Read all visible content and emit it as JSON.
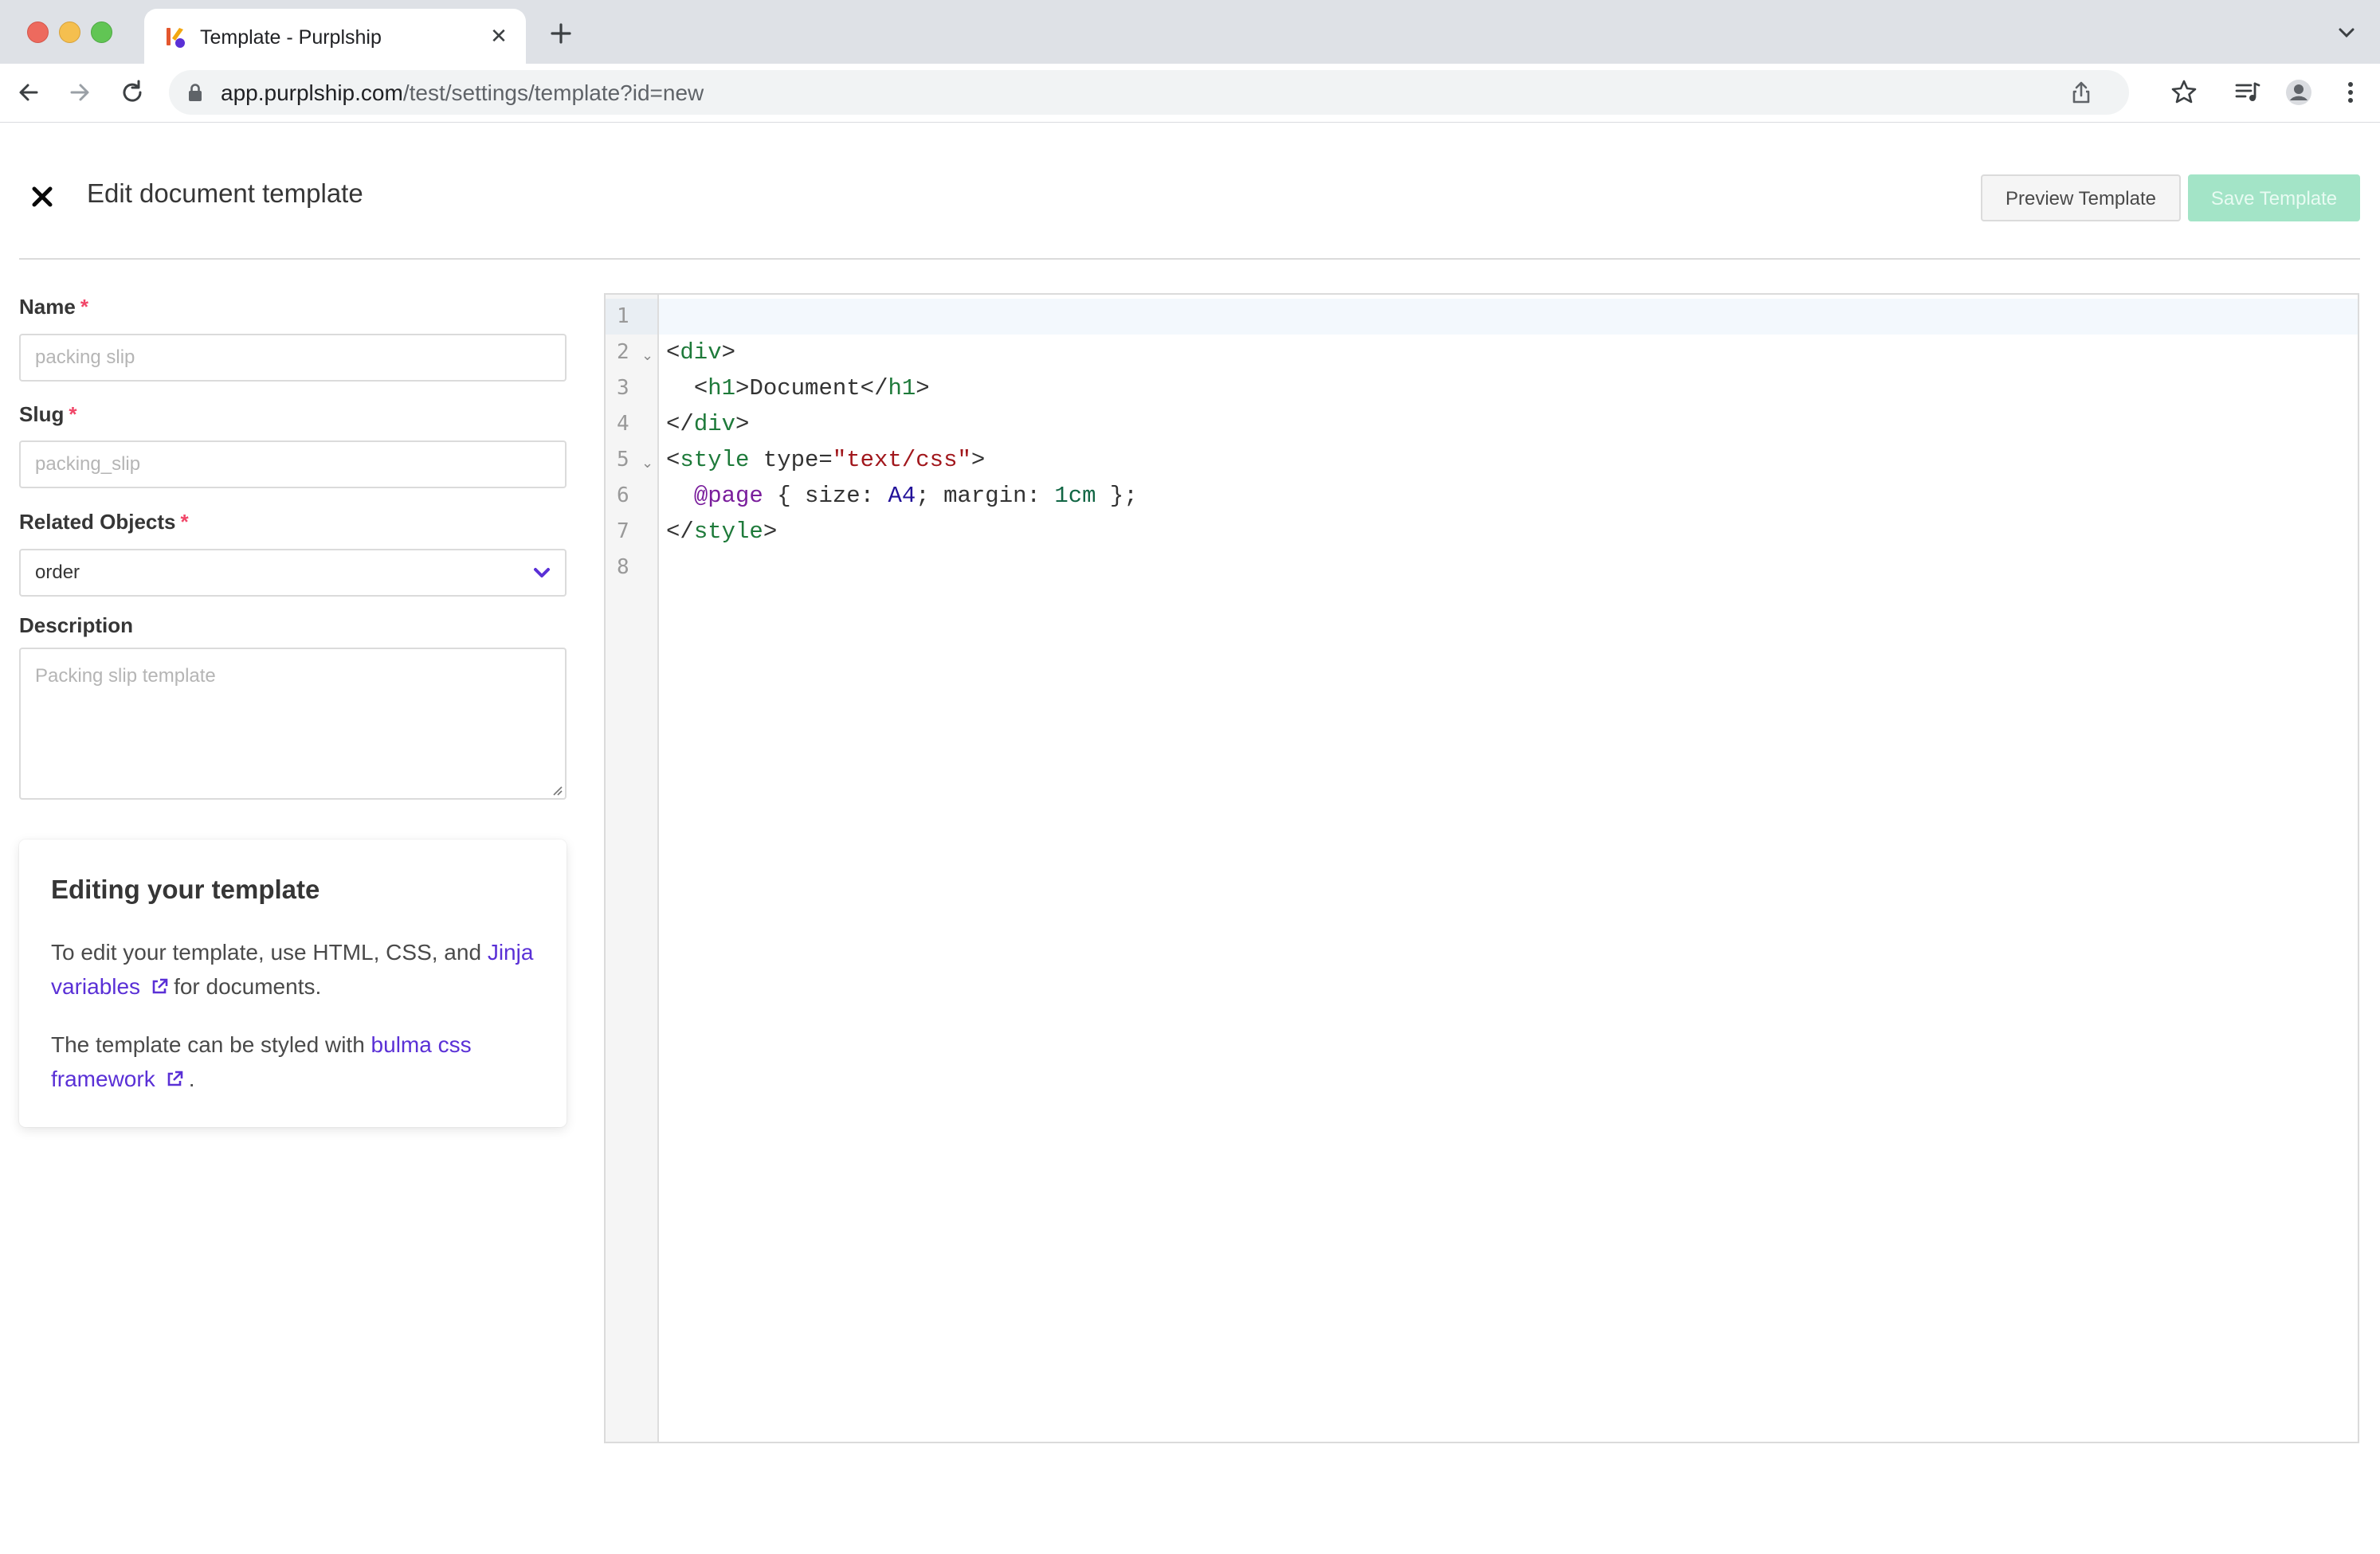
{
  "browser": {
    "tab_title": "Template - Purplship",
    "url_host": "app.purplship.com",
    "url_path": "/test/settings/template?id=new"
  },
  "header": {
    "title": "Edit document template",
    "preview_label": "Preview Template",
    "save_label": "Save Template"
  },
  "form": {
    "name_label": "Name",
    "name_placeholder": "packing slip",
    "slug_label": "Slug",
    "slug_placeholder": "packing_slip",
    "related_label": "Related Objects",
    "related_value": "order",
    "description_label": "Description",
    "description_placeholder": "Packing slip template",
    "required_mark": "*"
  },
  "help": {
    "title": "Editing your template",
    "p1_before": "To edit your template, use HTML, CSS, and",
    "p1_link": "Jinja variables",
    "p1_after": "for documents.",
    "p2_before": "The template can be styled with",
    "p2_link_a": "bulma css",
    "p2_link_b": "framework",
    "p2_after": "."
  },
  "editor": {
    "line_numbers": [
      "1",
      "2",
      "3",
      "4",
      "5",
      "6",
      "7",
      "8"
    ],
    "lines": [
      "",
      "<div>",
      "  <h1>Document</h1>",
      "</div>",
      "<style type=\"text/css\">",
      "  @page { size: A4; margin: 1cm };",
      "</style>",
      ""
    ]
  },
  "icons": {
    "accent": "#5a30d6",
    "required": "#f14668",
    "save_disabled": "#a3e4c7"
  }
}
